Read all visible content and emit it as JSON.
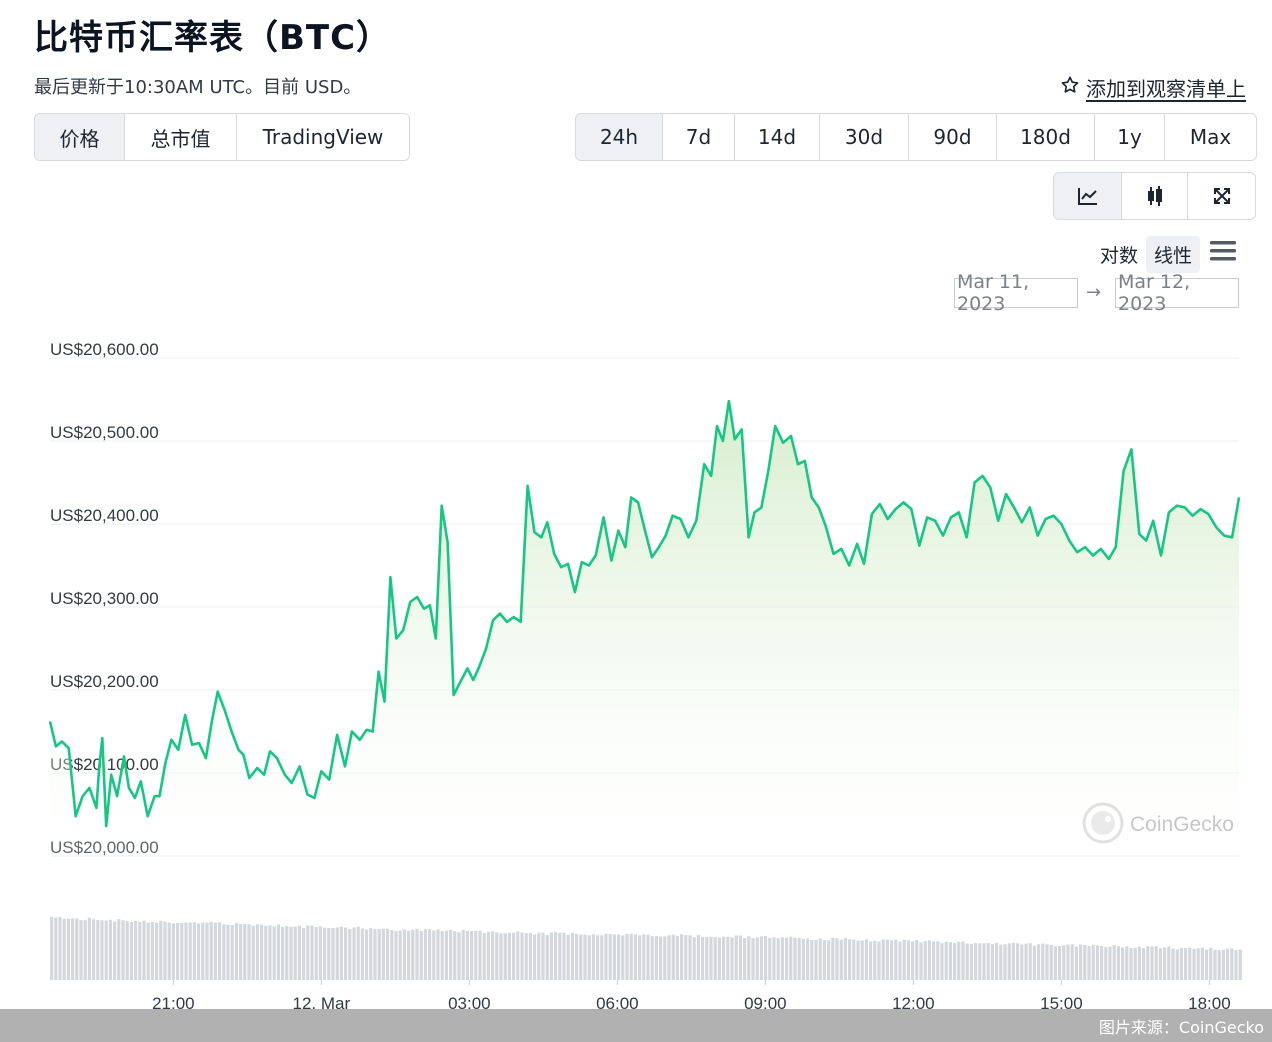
{
  "header": {
    "title": "比特币汇率表（BTC）",
    "subtitle": "最后更新于10:30AM UTC。目前 USD。",
    "watchlist_label": "添加到观察清单上"
  },
  "metric_tabs": [
    {
      "label": "价格",
      "active": true
    },
    {
      "label": "总市值",
      "active": false
    },
    {
      "label": "TradingView",
      "active": false
    }
  ],
  "range_tabs": [
    {
      "label": "24h",
      "active": true
    },
    {
      "label": "7d",
      "active": false
    },
    {
      "label": "14d",
      "active": false
    },
    {
      "label": "30d",
      "active": false
    },
    {
      "label": "90d",
      "active": false
    },
    {
      "label": "180d",
      "active": false
    },
    {
      "label": "1y",
      "active": false
    },
    {
      "label": "Max",
      "active": false
    }
  ],
  "view_tabs": [
    {
      "icon": "line-chart-icon",
      "active": true
    },
    {
      "icon": "candlestick-icon",
      "active": false
    },
    {
      "icon": "fullscreen-icon",
      "active": false
    }
  ],
  "scale": {
    "log_label": "对数",
    "linear_label": "线性",
    "active": "linear"
  },
  "date_range": {
    "from": "Mar 11, 2023",
    "to": "Mar 12, 2023",
    "arrow": "→"
  },
  "watermark": "CoinGecko",
  "footer": {
    "source": "图片来源：CoinGecko"
  },
  "colors": {
    "line": "#16c784",
    "area_top": "#d9f0d3",
    "grid": "#edeff2",
    "volume_bar": "#d4d7dc",
    "footer_bg": "#b1b1b1"
  },
  "chart_data": {
    "type": "area",
    "y_tick_labels": [
      "US$20,000.00",
      "US$20,100.00",
      "US$20,200.00",
      "US$20,300.00",
      "US$20,400.00",
      "US$20,500.00",
      "US$20,600.00"
    ],
    "y_ticks": [
      20000,
      20100,
      20200,
      20300,
      20400,
      20500,
      20600
    ],
    "ylim": [
      20000,
      20600
    ],
    "x_tick_labels": [
      "21:00",
      "12. Mar",
      "03:00",
      "06:00",
      "09:00",
      "12:00",
      "15:00",
      "18:00"
    ],
    "x_ticks": [
      21,
      24,
      27,
      30,
      33,
      36,
      39,
      42
    ],
    "xlim": [
      18.5,
      42.6
    ],
    "grid": true,
    "legend": "none",
    "price": {
      "x": [
        18.5,
        18.62,
        18.74,
        18.88,
        19.02,
        19.16,
        19.3,
        19.44,
        19.5,
        19.56,
        19.64,
        19.74,
        19.86,
        20.0,
        20.1,
        20.22,
        20.34,
        20.48,
        20.62,
        20.72,
        20.84,
        20.96,
        21.1,
        21.24,
        21.38,
        21.52,
        21.66,
        21.78,
        21.9,
        22.04,
        22.18,
        22.32,
        22.42,
        22.54,
        22.7,
        22.84,
        22.96,
        23.1,
        23.26,
        23.4,
        23.56,
        23.72,
        23.86,
        24.0,
        24.16,
        24.32,
        24.48,
        24.62,
        24.78,
        24.92,
        25.04,
        25.16,
        25.28,
        25.4,
        25.52,
        25.66,
        25.8,
        25.94,
        26.08,
        26.2,
        26.32,
        26.44,
        26.56,
        26.68,
        26.82,
        26.96,
        27.08,
        27.2,
        27.34,
        27.48,
        27.62,
        27.76,
        27.9,
        28.04,
        28.18,
        28.32,
        28.46,
        28.58,
        28.72,
        28.86,
        29.0,
        29.14,
        29.28,
        29.42,
        29.56,
        29.72,
        29.88,
        30.02,
        30.16,
        30.28,
        30.42,
        30.56,
        30.7,
        30.84,
        30.98,
        31.12,
        31.28,
        31.44,
        31.6,
        31.76,
        31.9,
        32.02,
        32.14,
        32.26,
        32.38,
        32.52,
        32.66,
        32.78,
        32.92,
        33.06,
        33.2,
        33.36,
        33.52,
        33.66,
        33.8,
        33.94,
        34.08,
        34.22,
        34.38,
        34.54,
        34.7,
        34.86,
        35.0,
        35.16,
        35.32,
        35.48,
        35.64,
        35.8,
        35.96,
        36.12,
        36.28,
        36.44,
        36.6,
        36.76,
        36.92,
        37.08,
        37.24,
        37.4,
        37.56,
        37.72,
        37.88,
        38.04,
        38.2,
        38.36,
        38.52,
        38.68,
        38.84,
        39.0,
        39.16,
        39.32,
        39.48,
        39.64,
        39.8,
        39.96,
        40.1,
        40.26,
        40.42,
        40.58,
        40.72,
        40.86,
        41.02,
        41.18,
        41.34,
        41.5,
        41.66,
        41.82,
        41.98,
        42.14,
        42.3,
        42.46,
        42.6
      ],
      "y": [
        20162,
        20132,
        20138,
        20130,
        20048,
        20072,
        20082,
        20058,
        20108,
        20142,
        20036,
        20098,
        20072,
        20120,
        20082,
        20070,
        20090,
        20048,
        20072,
        20072,
        20112,
        20140,
        20128,
        20170,
        20134,
        20136,
        20118,
        20162,
        20198,
        20176,
        20150,
        20128,
        20122,
        20094,
        20106,
        20098,
        20126,
        20118,
        20098,
        20088,
        20108,
        20074,
        20070,
        20102,
        20092,
        20146,
        20108,
        20150,
        20140,
        20152,
        20150,
        20222,
        20186,
        20336,
        20262,
        20272,
        20306,
        20312,
        20298,
        20302,
        20262,
        20422,
        20378,
        20194,
        20210,
        20226,
        20212,
        20228,
        20250,
        20284,
        20292,
        20282,
        20288,
        20282,
        20446,
        20390,
        20384,
        20402,
        20364,
        20348,
        20352,
        20318,
        20354,
        20350,
        20362,
        20408,
        20356,
        20392,
        20372,
        20432,
        20426,
        20392,
        20360,
        20372,
        20386,
        20410,
        20406,
        20384,
        20404,
        20472,
        20458,
        20518,
        20500,
        20548,
        20502,
        20514,
        20384,
        20414,
        20420,
        20464,
        20518,
        20498,
        20506,
        20472,
        20476,
        20432,
        20420,
        20398,
        20364,
        20370,
        20350,
        20376,
        20352,
        20412,
        20424,
        20406,
        20418,
        20426,
        20418,
        20374,
        20408,
        20404,
        20386,
        20408,
        20414,
        20384,
        20450,
        20458,
        20444,
        20404,
        20436,
        20420,
        20402,
        20420,
        20386,
        20406,
        20410,
        20400,
        20380,
        20366,
        20372,
        20362,
        20370,
        20358,
        20372,
        20464,
        20490,
        20388,
        20380,
        20404,
        20362,
        20414,
        20422,
        20420,
        20410,
        20418,
        20412,
        20396,
        20386,
        20384,
        20432
      ]
    },
    "volume": {
      "x": [
        18.5,
        19.5,
        20.5,
        21.5,
        22.5,
        23.5,
        24.5,
        25.5,
        26.5,
        27.5,
        28.5,
        29.5,
        30.5,
        31.5,
        32.5,
        33.5,
        34.5,
        35.5,
        36.5,
        37.5,
        38.5,
        39.5,
        40.5,
        41.5,
        42.6
      ],
      "values": [
        100,
        97,
        94,
        92,
        89,
        86,
        84,
        81,
        79,
        77,
        75,
        74,
        73,
        71,
        70,
        68,
        66,
        64,
        62,
        60,
        58,
        56,
        54,
        52,
        49
      ]
    }
  }
}
